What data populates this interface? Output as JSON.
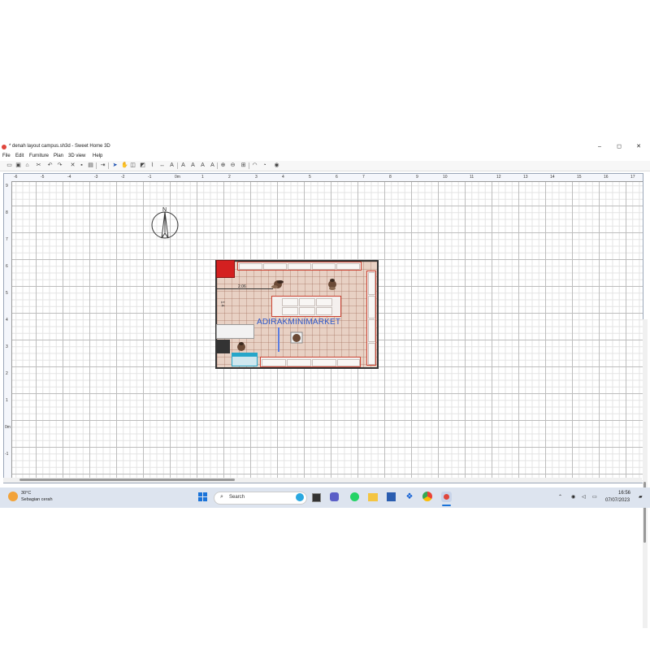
{
  "window": {
    "title": "* denah layout campus.sh3d - Sweet Home 3D",
    "controls": [
      "–",
      "◻",
      "✕"
    ]
  },
  "menu": [
    "File",
    "Edit",
    "Furniture",
    "Plan",
    "3D view",
    "Help"
  ],
  "ruler": {
    "top_labels": [
      "-6",
      "-5",
      "-4",
      "-3",
      "-2",
      "-1",
      "0m",
      "1",
      "2",
      "3",
      "4",
      "5",
      "6",
      "7",
      "8",
      "9",
      "10",
      "11",
      "12",
      "13",
      "14",
      "15",
      "16",
      "17"
    ],
    "left_labels": [
      "9",
      "8",
      "7",
      "6",
      "5",
      "4",
      "3",
      "2",
      "1",
      "0m",
      "-1"
    ]
  },
  "plan": {
    "compass_label": "N",
    "room_label": "ADIRAKMINIMARKET",
    "dimension_label": "2.06",
    "side_dimension_label": "1.4",
    "colors": {
      "floor": "#e8d1c4",
      "wall": "#333333",
      "shelf_outline": "#cc3333",
      "red_block": "#d42020",
      "label": "#2d57c8",
      "cooler": "#26a6c9"
    }
  },
  "taskbar": {
    "weather_temp": "30°C",
    "weather_desc": "Sebagian cerah",
    "search_placeholder": "Search",
    "time": "16:56",
    "date": "07/07/2023"
  }
}
